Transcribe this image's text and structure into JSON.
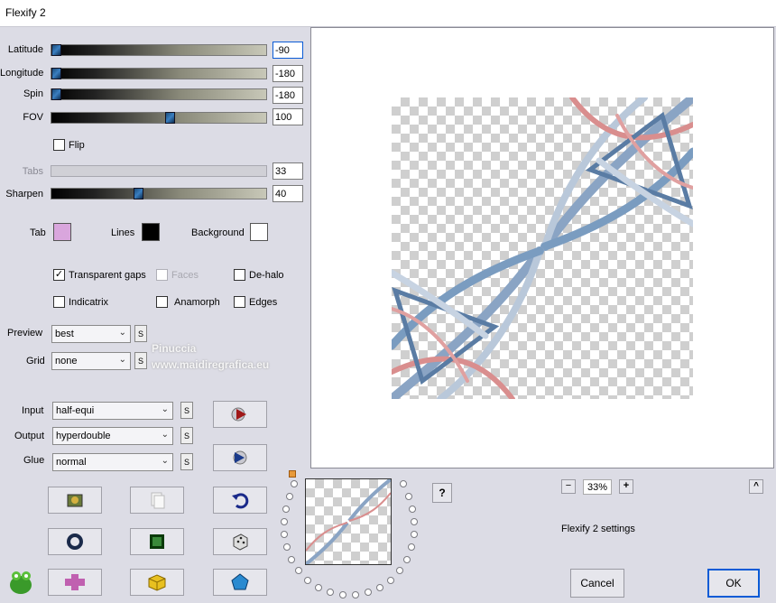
{
  "window": {
    "title": "Flexify 2"
  },
  "sliders": [
    {
      "label": "Latitude",
      "value": "-90",
      "level": 0.0
    },
    {
      "label": "Longitude",
      "value": "-180",
      "level": 0.0
    },
    {
      "label": "Spin",
      "value": "-180",
      "level": 0.0
    },
    {
      "label": "FOV",
      "value": "100",
      "level": 0.55
    },
    {
      "label": "Tabs",
      "value": "33",
      "level": 0.0
    },
    {
      "label": "Sharpen",
      "value": "40",
      "level": 0.4
    }
  ],
  "flip": {
    "label": "Flip",
    "checked": false
  },
  "colors": {
    "tab_label": "Tab",
    "tab_color": "#d9a6dd",
    "lines_label": "Lines",
    "lines_color": "#000000",
    "background_label": "Background",
    "background_color": "#ffffff"
  },
  "options": {
    "transparent_gaps": "Transparent gaps",
    "faces": "Faces",
    "de_halo": "De-halo",
    "indicatrix": "Indicatrix",
    "anamorph": "Anamorph",
    "edges": "Edges"
  },
  "preview_select": {
    "label": "Preview",
    "value": "best"
  },
  "grid_select": {
    "label": "Grid",
    "value": "none"
  },
  "input_select": {
    "label": "Input",
    "value": "half-equi"
  },
  "output_select": {
    "label": "Output",
    "value": "hyperdouble"
  },
  "glue_select": {
    "label": "Glue",
    "value": "normal"
  },
  "s_label": "S",
  "watermark": {
    "line1": "Pinuccia",
    "line2": "www.maidiregrafica.eu"
  },
  "zoom": {
    "minus": "−",
    "value": "33%",
    "plus": "+"
  },
  "help": "?",
  "collapse": "^",
  "settings_label": "Flexify 2 settings",
  "buttons": {
    "cancel": "Cancel",
    "ok": "OK"
  },
  "accent": "#0a5bd6"
}
